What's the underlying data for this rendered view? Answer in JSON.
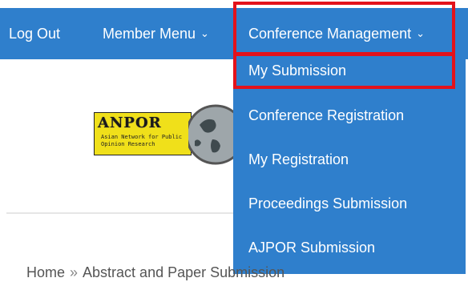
{
  "nav": {
    "logout": "Log Out",
    "member_menu": "Member Menu",
    "conference_management": "Conference Management",
    "chevron": "⌄"
  },
  "dropdown": {
    "items": [
      "My Submission",
      "Conference Registration",
      "My Registration",
      "Proceedings Submission",
      "AJPOR Submission"
    ]
  },
  "logo": {
    "title": "ANPOR",
    "subtitle": "Asian Network for Public Opinion Research"
  },
  "breadcrumb": {
    "home": "Home",
    "separator": "»",
    "current": "Abstract and Paper Submission"
  },
  "colors": {
    "nav_bg": "#2f7fcc",
    "highlight": "#e3121b",
    "logo_yellow": "#f0e01a"
  }
}
